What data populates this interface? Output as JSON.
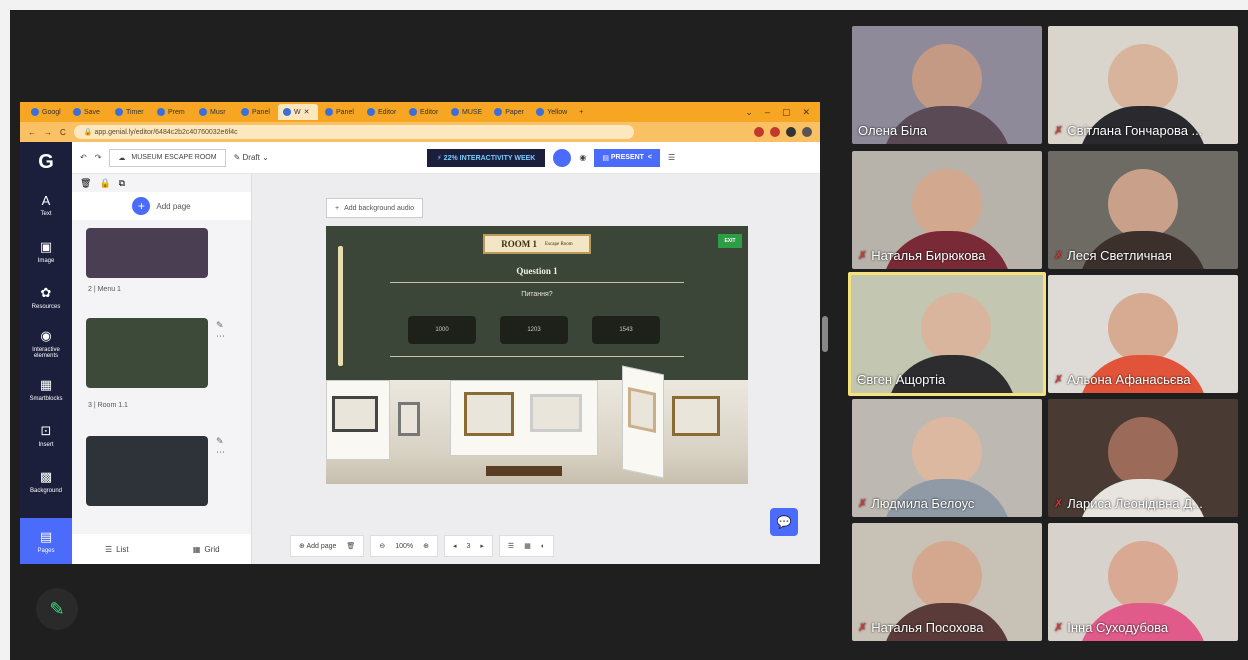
{
  "browser": {
    "tabs": [
      "Googl",
      "Save",
      "Timer",
      "Prem",
      "Musr",
      "Panel",
      "W",
      "Panel",
      "Editor",
      "Editor",
      "MUSE",
      "Paper",
      "Yellow"
    ],
    "url": "app.genial.ly/editor/6484c2b2c40760032e6f4c",
    "window_controls": [
      "⌄",
      "–",
      "▢",
      "✕"
    ]
  },
  "app": {
    "logo": "G",
    "leftbar": [
      {
        "label": "Text",
        "icon": "A"
      },
      {
        "label": "Image",
        "icon": "▣"
      },
      {
        "label": "Resources",
        "icon": "✿"
      },
      {
        "label": "Interactive elements",
        "icon": "◉"
      },
      {
        "label": "Smartblocks",
        "icon": "▦"
      },
      {
        "label": "Insert",
        "icon": "⊡"
      },
      {
        "label": "Background",
        "icon": "▩"
      },
      {
        "label": "Pages",
        "icon": "▤"
      }
    ],
    "title": "MUSEUM ESCAPE ROOM",
    "draft": "Draft",
    "promo": "⚡ 22% INTERACTIVITY WEEK",
    "present": "PRESENT",
    "add_page": "Add page",
    "thumbs": [
      {
        "label": "2 | Menu 1"
      },
      {
        "label": "3 | Room 1.1"
      },
      {
        "label": ""
      }
    ],
    "view_list": "List",
    "view_grid": "Grid",
    "bg_audio": "Add background audio",
    "slide": {
      "room": "ROOM 1",
      "room_sub": "Escape Room",
      "exit": "EXIT",
      "question": "Question 1",
      "question_text": "Питання?",
      "answers": [
        "1000",
        "1203",
        "1543"
      ]
    },
    "bottombar": {
      "add_page": "Add page",
      "zoom": "100%",
      "page": "3"
    }
  },
  "participants": [
    {
      "name": "Олена Біла",
      "muted": false
    },
    {
      "name": "Світлана Гончарова ...",
      "muted": true
    },
    {
      "name": "Наталья Бирюкова",
      "muted": true
    },
    {
      "name": "Леся Светличная",
      "muted": true
    },
    {
      "name": "Євген Ащортіа",
      "muted": false
    },
    {
      "name": "Альона Афанасьєва",
      "muted": true
    },
    {
      "name": "Людмила Белоус",
      "muted": true
    },
    {
      "name": "Лариса Леонідівна Д...",
      "muted": true
    },
    {
      "name": "Наталья Посохова",
      "muted": true
    },
    {
      "name": "Інна Суходубова",
      "muted": true
    }
  ]
}
